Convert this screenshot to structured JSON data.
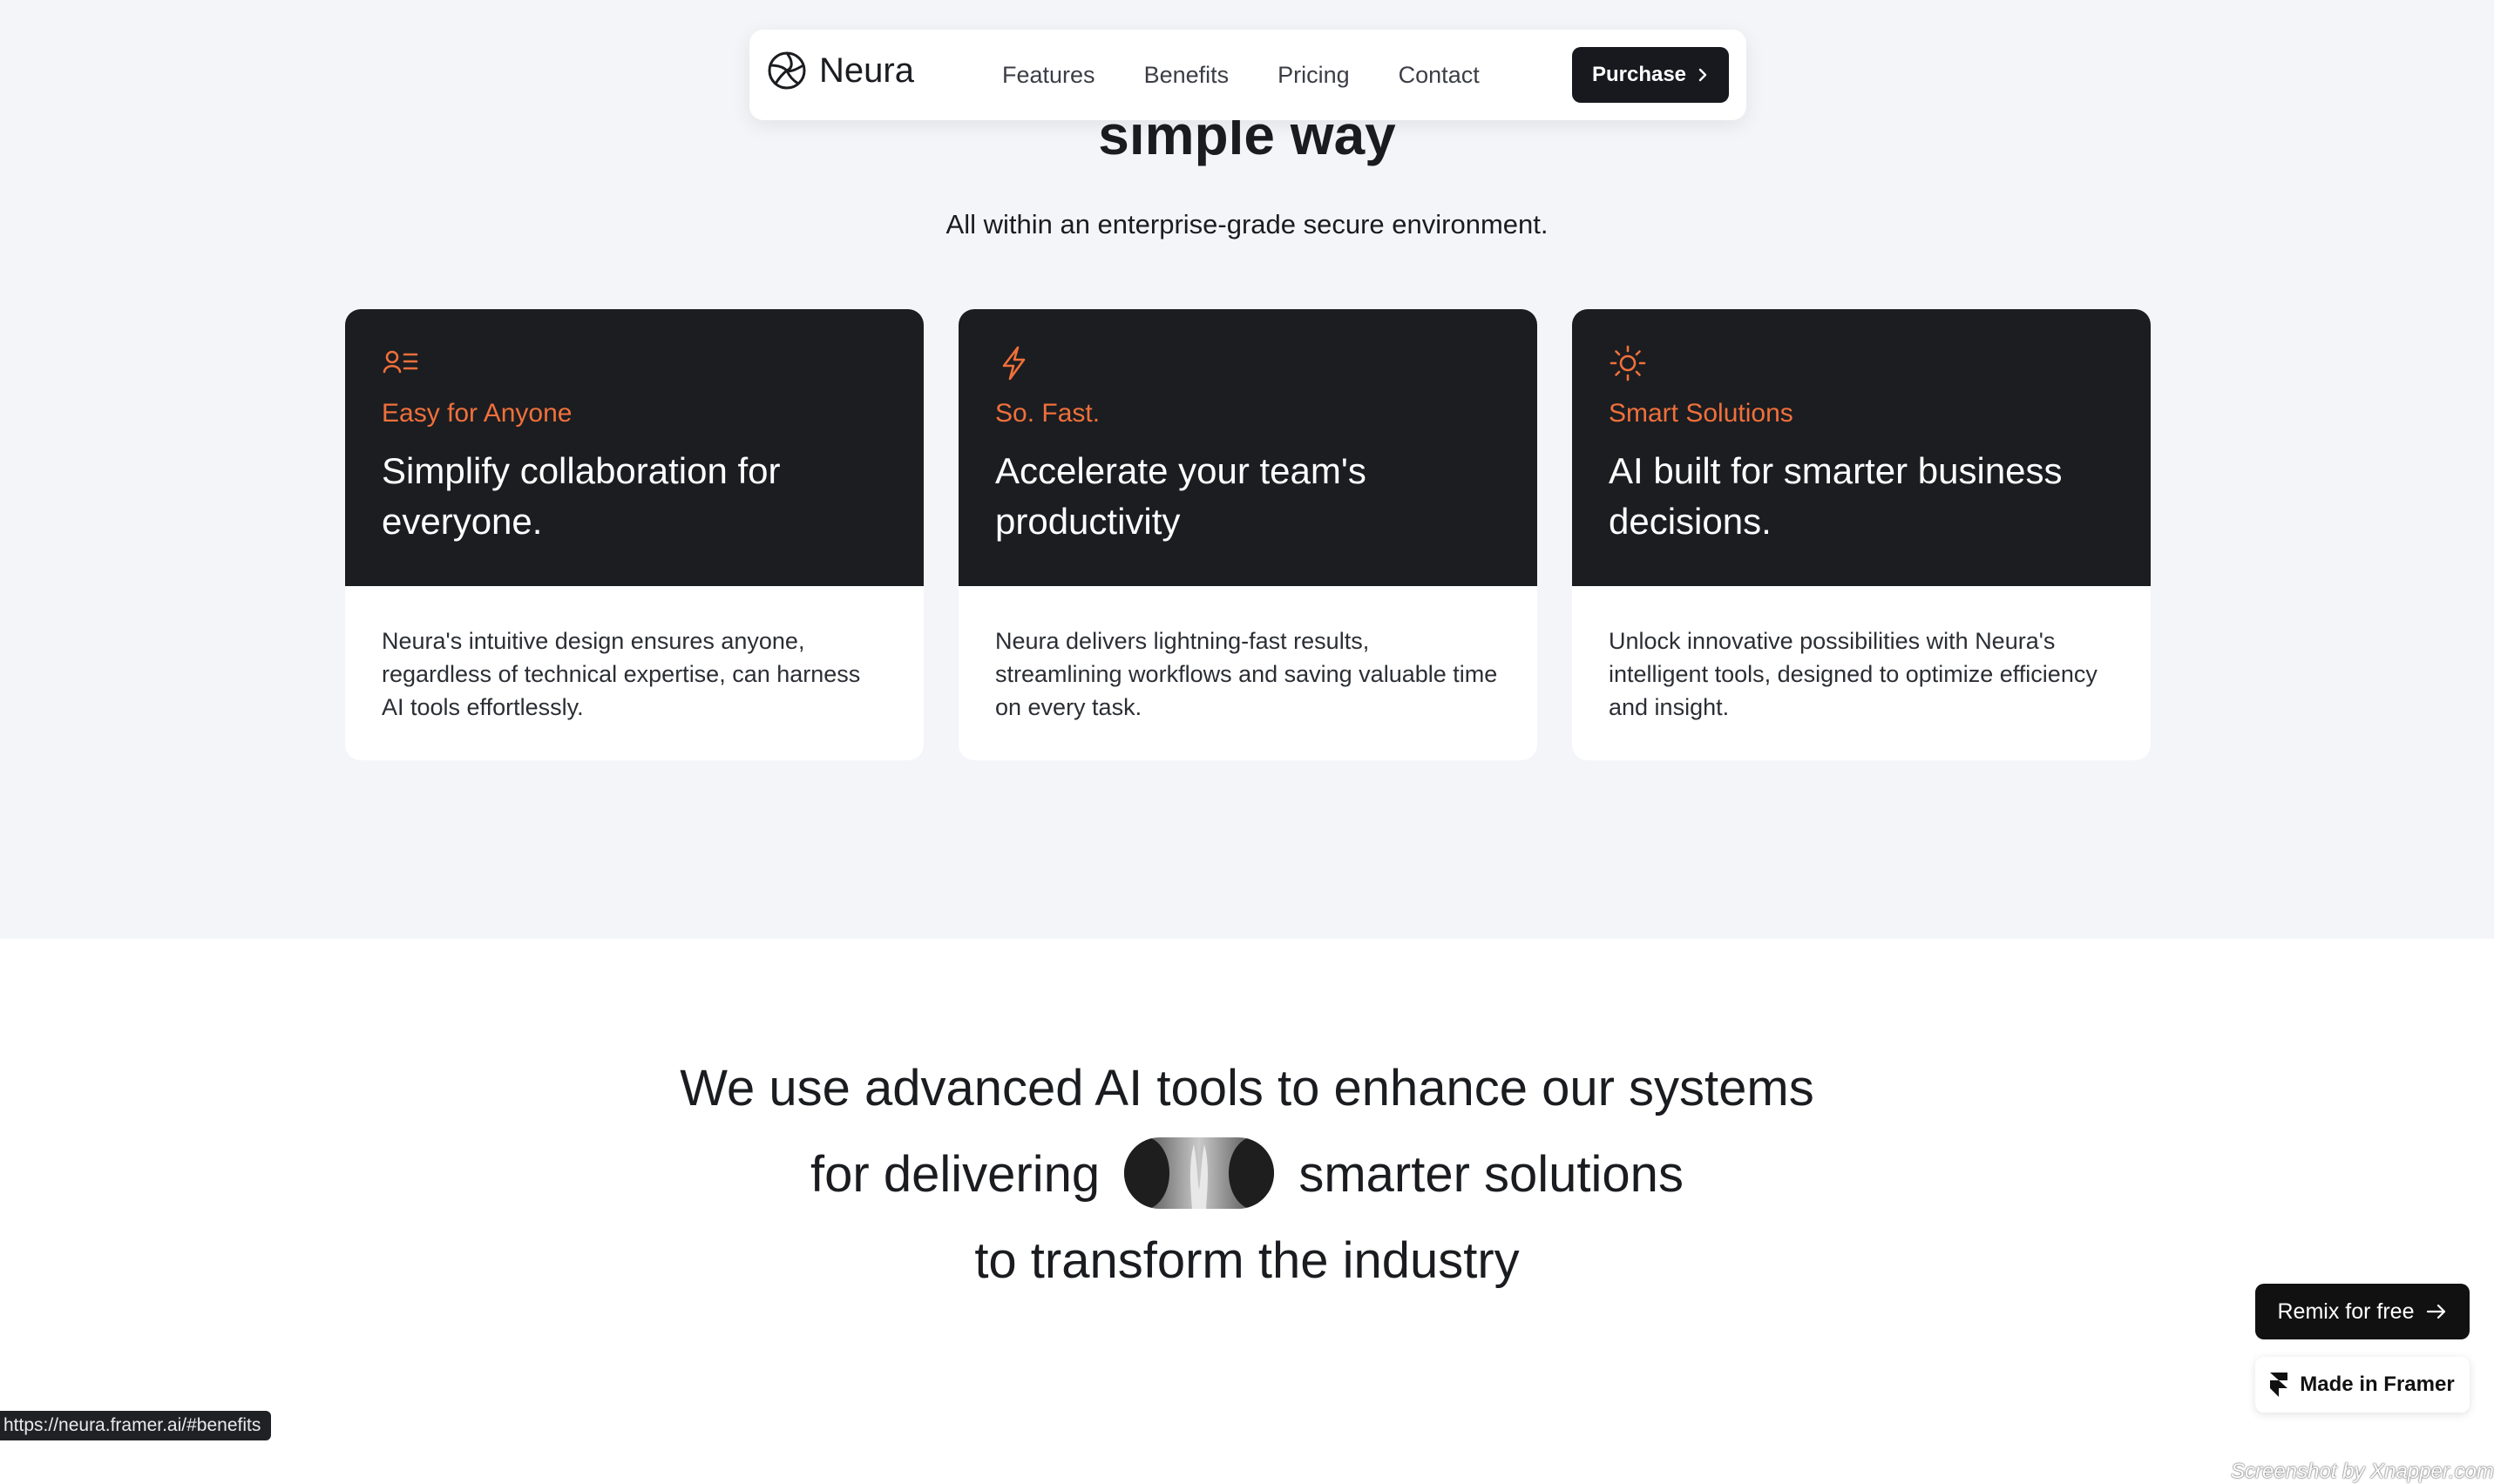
{
  "nav": {
    "brand": "Neura",
    "links": [
      "Features",
      "Benefits",
      "Pricing",
      "Contact"
    ],
    "purchase_label": "Purchase"
  },
  "hero": {
    "heading_partial": "simple way",
    "subheading": "All within an enterprise-grade secure environment."
  },
  "cards": [
    {
      "icon": "user-list-icon",
      "tag": "Easy for Anyone",
      "title": "Simplify collaboration for everyone.",
      "body": "Neura's intuitive design ensures anyone, regardless of technical expertise, can harness AI tools effortlessly."
    },
    {
      "icon": "lightning-icon",
      "tag": "So. Fast.",
      "title": "Accelerate your team's productivity",
      "body": "Neura delivers lightning-fast results, streamlining workflows and saving valuable time on every task."
    },
    {
      "icon": "sun-icon",
      "tag": "Smart Solutions",
      "title": "AI built for smarter business decisions.",
      "body": "Unlock innovative possibilities with Neura's intelligent tools, designed to optimize efficiency and insight."
    }
  ],
  "statement": {
    "line1": "We use advanced AI tools to enhance our systems",
    "line2_before": "for delivering",
    "line2_after": "smarter solutions",
    "line3": "to transform the industry"
  },
  "floating": {
    "remix_label": "Remix for free",
    "framer_label": "Made in Framer"
  },
  "status_bar_url": "https://neura.framer.ai/#benefits",
  "watermark": "Screenshot by Xnapper.com",
  "colors": {
    "accent": "#f0703a",
    "card_dark": "#1b1d21",
    "section_bg": "#f4f5f9"
  }
}
